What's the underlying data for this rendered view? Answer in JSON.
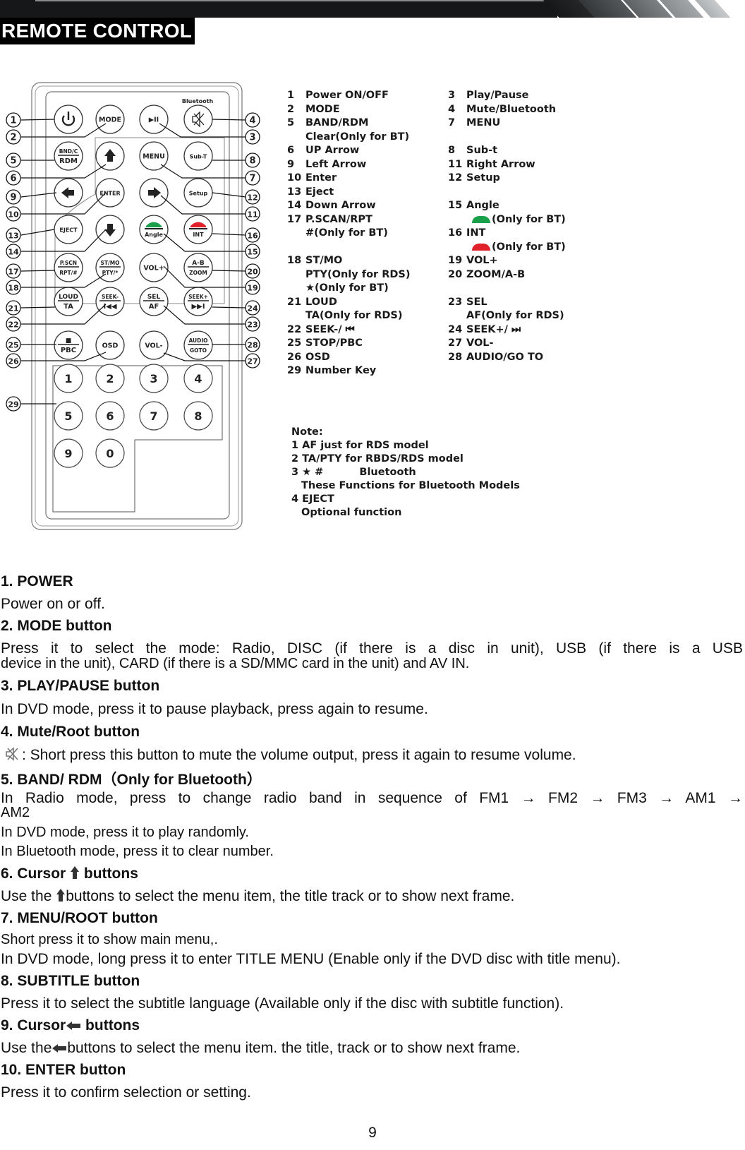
{
  "header": {
    "title": "REMOTE CONTROL"
  },
  "remote": {
    "top_label": "Bluetooth",
    "buttons": [
      {
        "id": "power",
        "label": "",
        "icon": "power-icon"
      },
      {
        "id": "mode",
        "label": "MODE"
      },
      {
        "id": "play-pause",
        "label": "▶II"
      },
      {
        "id": "mute",
        "label": "",
        "icon": "mute-icon"
      },
      {
        "id": "band",
        "top": "BND/C",
        "bottom": "RDM"
      },
      {
        "id": "up",
        "label": "",
        "icon": "up-arrow-icon"
      },
      {
        "id": "menu",
        "label": "MENU"
      },
      {
        "id": "sub-t",
        "label": "Sub-T"
      },
      {
        "id": "left",
        "label": "",
        "icon": "left-arrow-icon"
      },
      {
        "id": "enter",
        "label": "ENTER"
      },
      {
        "id": "right",
        "label": "",
        "icon": "right-arrow-icon"
      },
      {
        "id": "setup",
        "label": "Setup"
      },
      {
        "id": "eject",
        "label": "EJECT"
      },
      {
        "id": "down",
        "label": "",
        "icon": "down-arrow-icon"
      },
      {
        "id": "angle",
        "label": "Angle",
        "icon": "phone-answer-icon"
      },
      {
        "id": "int",
        "label": "INT",
        "icon": "phone-hangup-icon"
      },
      {
        "id": "pscn",
        "top": "P.SCN",
        "bottom": "RPT/#"
      },
      {
        "id": "stmo",
        "top": "ST/MO",
        "bottom": "PTY/*"
      },
      {
        "id": "volup",
        "label": "VOL+"
      },
      {
        "id": "ab",
        "top": "A-B",
        "bottom": "ZOOM"
      },
      {
        "id": "loud",
        "top": "LOUD",
        "bottom": "TA"
      },
      {
        "id": "seekm",
        "top": "SEEK-",
        "bottom": "I◀◀"
      },
      {
        "id": "sel",
        "top": "SEL",
        "bottom": "AF"
      },
      {
        "id": "seekp",
        "top": "SEEK+",
        "bottom": "▶▶I"
      },
      {
        "id": "pbc",
        "top": "■",
        "bottom": "PBC"
      },
      {
        "id": "osd",
        "label": "OSD"
      },
      {
        "id": "voldn",
        "label": "VOL-"
      },
      {
        "id": "audio",
        "top": "AUDIO",
        "bottom": "GOTO"
      }
    ],
    "number_keys": [
      "1",
      "2",
      "3",
      "4",
      "5",
      "6",
      "7",
      "8",
      "9",
      "0"
    ],
    "callouts_left": [
      "1",
      "2",
      "5",
      "6",
      "9",
      "10",
      "13",
      "14",
      "17",
      "18",
      "21",
      "22",
      "25",
      "26",
      "29"
    ],
    "callouts_right": [
      "4",
      "3",
      "8",
      "7",
      "12",
      "11",
      "16",
      "15",
      "20",
      "19",
      "24",
      "23",
      "28",
      "27"
    ]
  },
  "legend": {
    "left": [
      {
        "num": "1",
        "text": "Power ON/OFF"
      },
      {
        "num": "2",
        "text": "MODE"
      },
      {
        "num": "5",
        "text": "BAND/RDM"
      },
      {
        "num": "",
        "text": "Clear(Only for BT)"
      },
      {
        "num": "6",
        "text": "UP Arrow"
      },
      {
        "num": "9",
        "text": "Left Arrow"
      },
      {
        "num": "10",
        "text": "Enter"
      },
      {
        "num": "13",
        "text": "Eject"
      },
      {
        "num": "14",
        "text": "Down Arrow"
      },
      {
        "num": "17",
        "text": "P.SCAN/RPT"
      },
      {
        "num": "",
        "text": "#(Only for BT)"
      },
      {
        "num": "18",
        "text": "ST/MO"
      },
      {
        "num": "",
        "text": "PTY(Only for RDS)"
      },
      {
        "num": "",
        "text": "★(Only for BT)"
      },
      {
        "num": "21",
        "text": "LOUD"
      },
      {
        "num": "",
        "text": "TA(Only for RDS)"
      },
      {
        "num": "22",
        "text": "SEEK-/ ⏮"
      },
      {
        "num": "25",
        "text": "STOP/PBC"
      },
      {
        "num": "26",
        "text": "OSD"
      },
      {
        "num": "29",
        "text": "Number Key"
      }
    ],
    "right": [
      {
        "num": "3",
        "text": "Play/Pause"
      },
      {
        "num": "4",
        "text": "Mute/Bluetooth"
      },
      {
        "num": "7",
        "text": "MENU"
      },
      {
        "num": "8",
        "text": "Sub-t"
      },
      {
        "num": "11",
        "text": "Right Arrow"
      },
      {
        "num": "12",
        "text": "Setup"
      },
      {
        "num": "15",
        "text": "Angle"
      },
      {
        "num": "",
        "text": "(Only for BT)",
        "phone": "green"
      },
      {
        "num": "16",
        "text": "INT"
      },
      {
        "num": "",
        "text": "(Only for BT)",
        "phone": "red"
      },
      {
        "num": "19",
        "text": "VOL+"
      },
      {
        "num": "20",
        "text": "ZOOM/A-B"
      },
      {
        "num": "23",
        "text": "SEL"
      },
      {
        "num": "",
        "text": "AF(Only for RDS)"
      },
      {
        "num": "24",
        "text": "SEEK+/ ⏭"
      },
      {
        "num": "27",
        "text": "VOL-"
      },
      {
        "num": "28",
        "text": "AUDIO/GO TO"
      }
    ]
  },
  "note": {
    "title": "Note:",
    "lines": [
      "1 AF  just for RDS model",
      "2 TA/PTY for RBDS/RDS model",
      "3 ★  #",
      "Bluetooth",
      "These Functions for Bluetooth Models",
      "4 EJECT",
      "Optional function"
    ],
    "colors": {
      "answer": "#1aa04a",
      "hangup": "#e0202a"
    }
  },
  "sections": [
    {
      "heading": "1. POWER",
      "body": [
        "Power on or off."
      ]
    },
    {
      "heading": "2. MODE button",
      "body": [
        "Press it to select the mode: Radio, DISC (if there is a disc in unit), USB (if there is a USB",
        "device in the unit), CARD (if there is a SD/MMC card in the unit) and AV IN."
      ]
    },
    {
      "heading": "3. PLAY/PAUSE button",
      "body": [
        "In DVD mode, press it to pause playback, press again to resume."
      ]
    },
    {
      "heading": "4. Mute/Root button",
      "body": [
        ": Short press this button to mute the volume output, press it again to resume volume."
      ]
    },
    {
      "heading": "5. BAND/ RDM（Only for Bluetooth）",
      "body": [
        "In Radio mode, press to change radio band in sequence of FM1 → FM2 → FM3 → AM1 →",
        "AM2",
        "In DVD mode, press it to play randomly.",
        "In Bluetooth mode, press it to clear number."
      ]
    },
    {
      "heading_pre": "6. Cursor",
      "heading_post": "buttons",
      "body_pre": "Use the",
      "body_post": "buttons to select the menu item, the title track or to show next frame."
    },
    {
      "heading": "7. MENU/ROOT button",
      "body": [
        "Short press it to show main menu,.",
        "In DVD mode, long press it to enter TITLE MENU (Enable only if the DVD disc with title menu)."
      ]
    },
    {
      "heading": "8. SUBTITLE button",
      "body": [
        "Press it to select the subtitle language (Available only if the disc with subtitle function)."
      ]
    },
    {
      "heading_pre": "9. Cursor",
      "heading_post": "buttons",
      "body_pre": "Use the",
      "body_post": "buttons to select the menu item. the title, track or to show next frame."
    },
    {
      "heading": "10. ENTER button",
      "body": [
        "Press it to confirm selection or setting."
      ]
    }
  ],
  "footer": {
    "page_number": "9"
  }
}
